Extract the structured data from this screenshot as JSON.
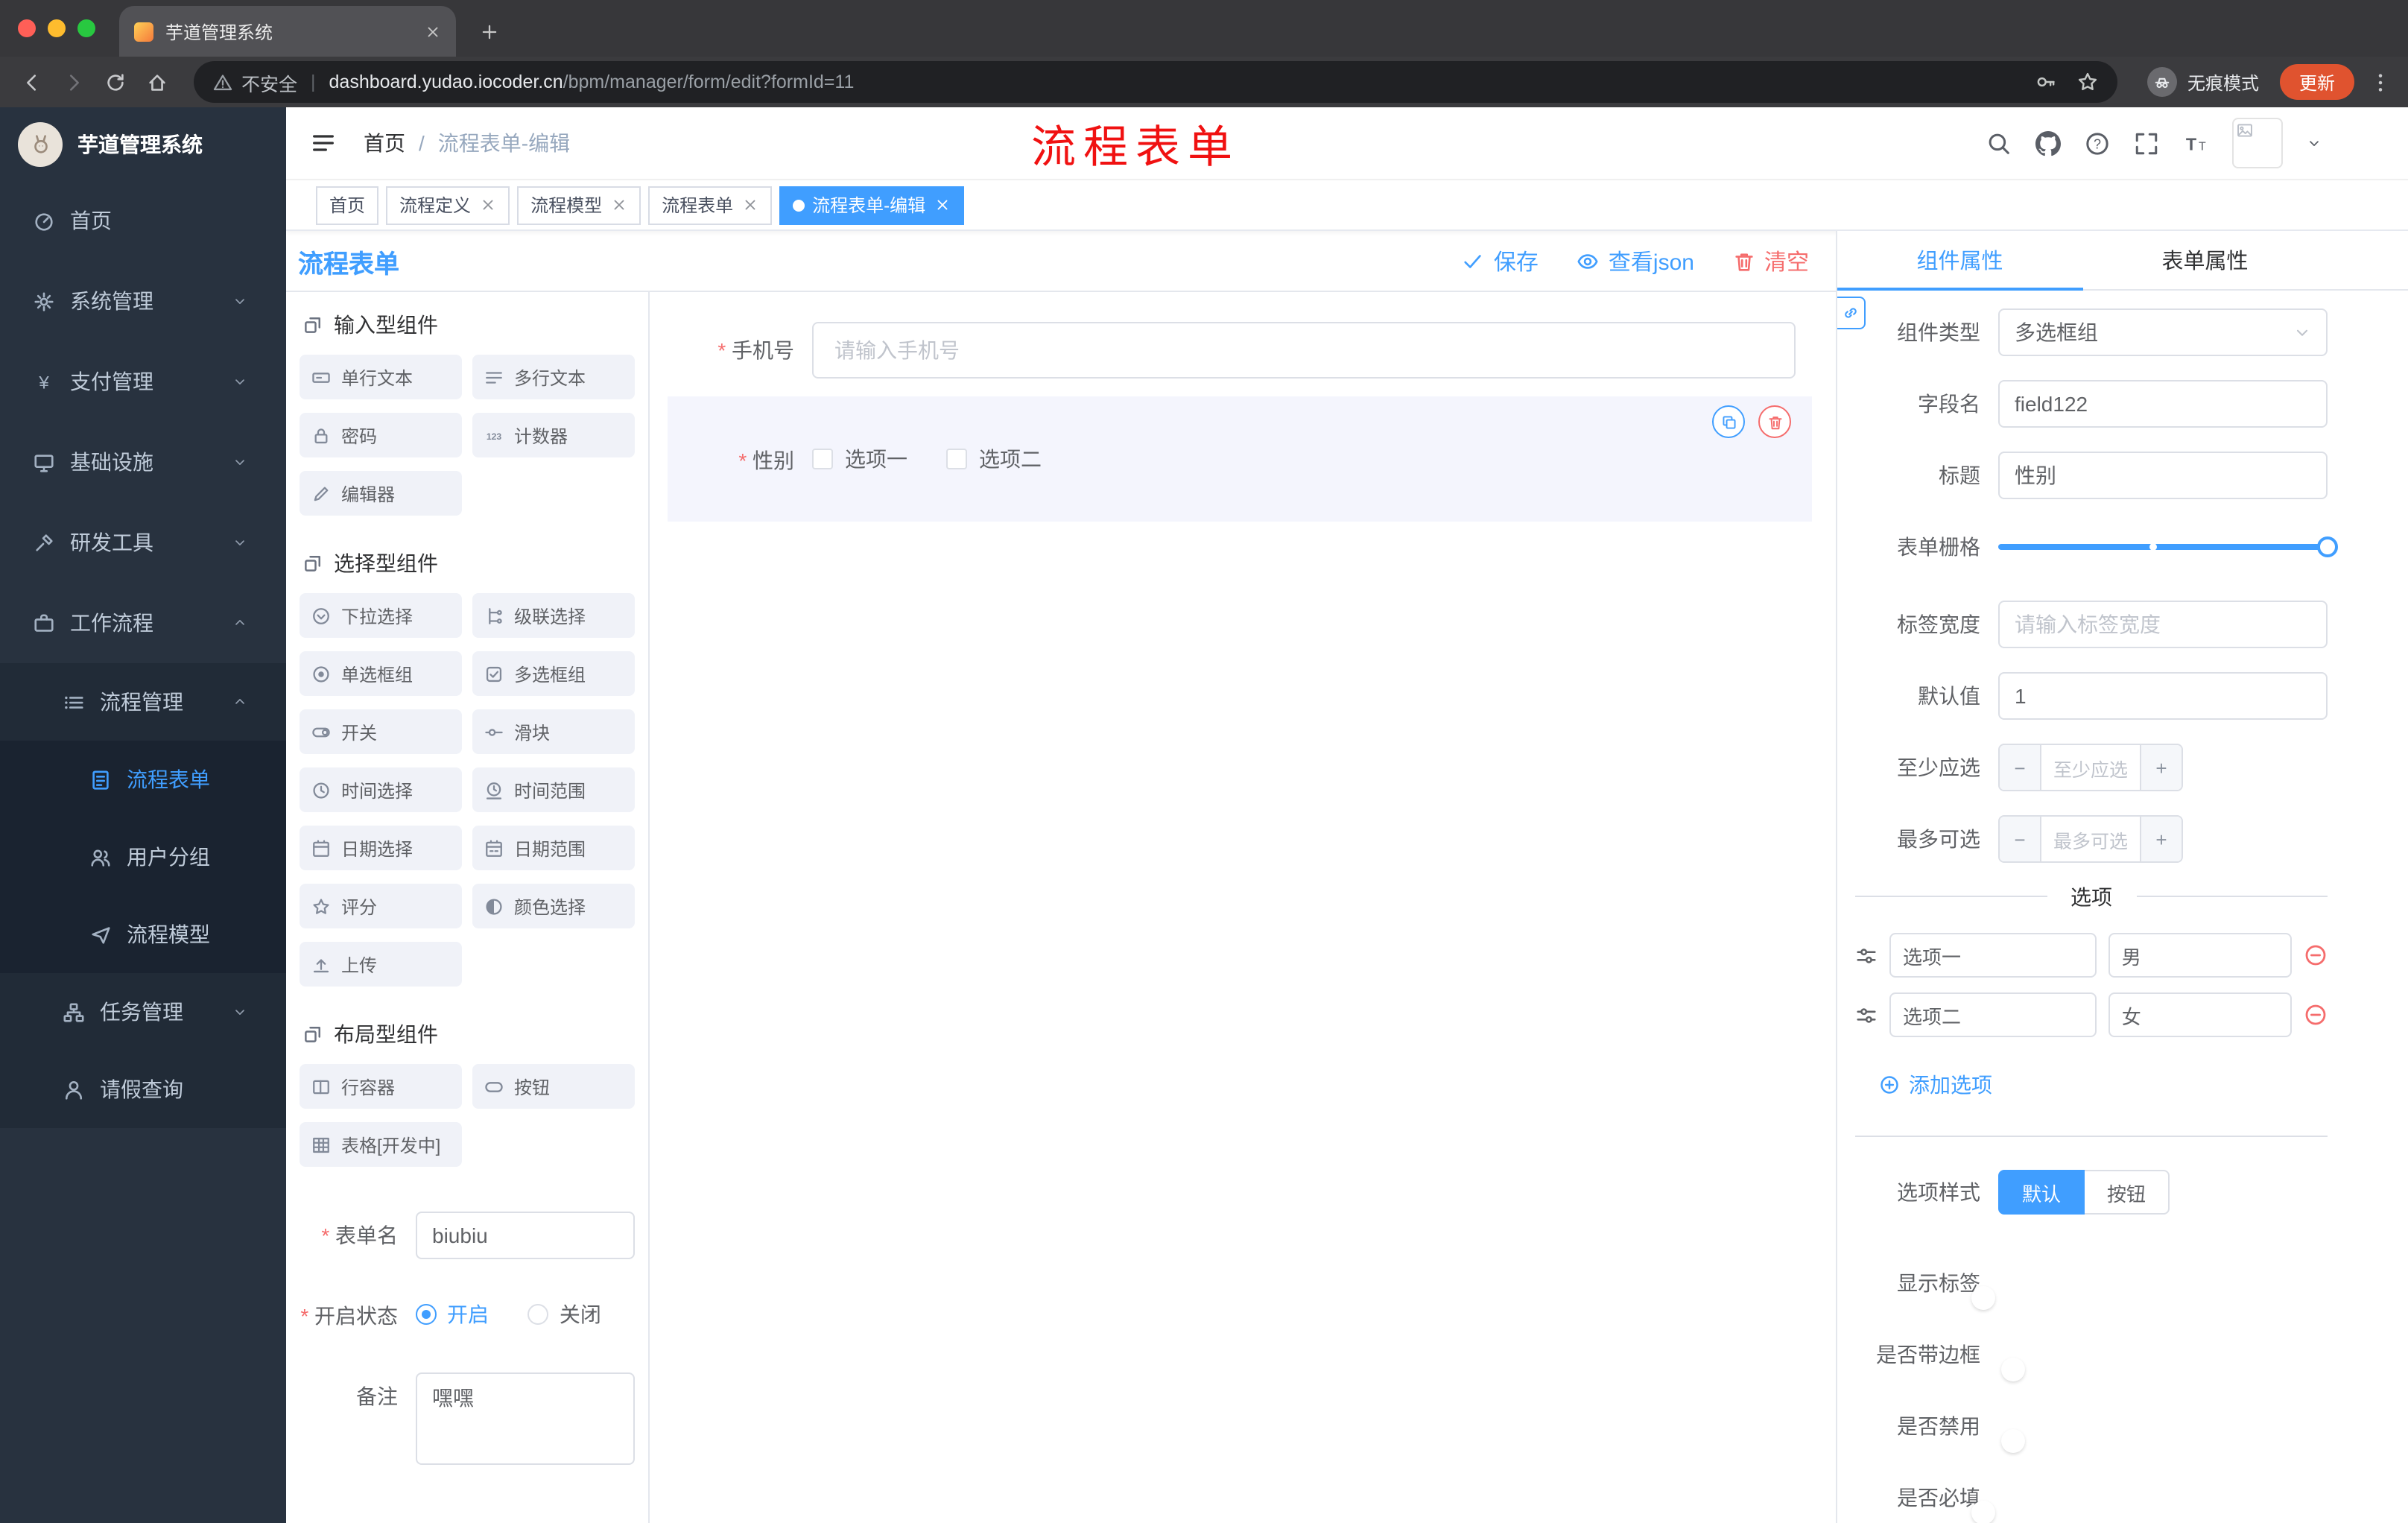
{
  "browser": {
    "tab_title": "芋道管理系统",
    "security_label": "不安全",
    "url_domain": "dashboard.yudao.iocoder.cn",
    "url_path": "/bpm/manager/form/edit?formId=11",
    "incognito_label": "无痕模式",
    "update_label": "更新"
  },
  "sidebar": {
    "title": "芋道管理系统",
    "menu": [
      {
        "key": "home",
        "label": "首页",
        "icon": "dashboard-icon",
        "level": 1
      },
      {
        "key": "system-management",
        "label": "系统管理",
        "icon": "gear-icon",
        "level": 1,
        "arrow": "down"
      },
      {
        "key": "payment-management",
        "label": "支付管理",
        "icon": "payment-icon",
        "level": 1,
        "arrow": "down"
      },
      {
        "key": "infrastructure",
        "label": "基础设施",
        "icon": "infrastructure-icon",
        "level": 1,
        "arrow": "down"
      },
      {
        "key": "dev-tools",
        "label": "研发工具",
        "icon": "devtools-icon",
        "level": 1,
        "arrow": "down"
      },
      {
        "key": "workflow",
        "label": "工作流程",
        "icon": "workflow-icon",
        "level": 1,
        "arrow": "up"
      },
      {
        "key": "process-management",
        "label": "流程管理",
        "icon": "process-icon",
        "level": 2,
        "arrow": "up"
      },
      {
        "key": "process-form",
        "label": "流程表单",
        "icon": "form-icon",
        "level": 3,
        "active": true
      },
      {
        "key": "user-group",
        "label": "用户分组",
        "icon": "user-group-icon",
        "level": 3
      },
      {
        "key": "process-model",
        "label": "流程模型",
        "icon": "model-icon",
        "level": 3
      },
      {
        "key": "task-management",
        "label": "任务管理",
        "icon": "task-icon",
        "level": 2,
        "arrow": "down"
      },
      {
        "key": "leave-query",
        "label": "请假查询",
        "icon": "leave-icon",
        "level": 2
      }
    ]
  },
  "header": {
    "breadcrumb_home": "首页",
    "breadcrumb_sep": "/",
    "breadcrumb_current": "流程表单-编辑",
    "annotation": "流程表单"
  },
  "tags": [
    {
      "label": "首页",
      "closable": false,
      "active": false
    },
    {
      "label": "流程定义",
      "closable": true,
      "active": false
    },
    {
      "label": "流程模型",
      "closable": true,
      "active": false
    },
    {
      "label": "流程表单",
      "closable": true,
      "active": false
    },
    {
      "label": "流程表单-编辑",
      "closable": true,
      "active": true
    }
  ],
  "designer": {
    "title": "流程表单",
    "actions": {
      "save": "保存",
      "view_json": "查看json",
      "clear": "清空"
    }
  },
  "palette": {
    "sections": [
      {
        "title": "输入型组件",
        "items": [
          {
            "label": "单行文本",
            "icon": "input-icon"
          },
          {
            "label": "多行文本",
            "icon": "textarea-icon"
          },
          {
            "label": "密码",
            "icon": "password-icon"
          },
          {
            "label": "计数器",
            "icon": "counter-icon"
          },
          {
            "label": "编辑器",
            "icon": "editor-icon"
          }
        ]
      },
      {
        "title": "选择型组件",
        "items": [
          {
            "label": "下拉选择",
            "icon": "select-icon"
          },
          {
            "label": "级联选择",
            "icon": "cascader-icon"
          },
          {
            "label": "单选框组",
            "icon": "radio-icon"
          },
          {
            "label": "多选框组",
            "icon": "checkbox-icon"
          },
          {
            "label": "开关",
            "icon": "switch-icon"
          },
          {
            "label": "滑块",
            "icon": "slider-icon"
          },
          {
            "label": "时间选择",
            "icon": "time-icon"
          },
          {
            "label": "时间范围",
            "icon": "time-range-icon"
          },
          {
            "label": "日期选择",
            "icon": "date-icon"
          },
          {
            "label": "日期范围",
            "icon": "date-range-icon"
          },
          {
            "label": "评分",
            "icon": "rate-icon"
          },
          {
            "label": "颜色选择",
            "icon": "color-icon"
          },
          {
            "label": "上传",
            "icon": "upload-icon"
          }
        ]
      },
      {
        "title": "布局型组件",
        "items": [
          {
            "label": "行容器",
            "icon": "row-icon"
          },
          {
            "label": "按钮",
            "icon": "button-icon"
          },
          {
            "label": "表格[开发中]",
            "icon": "table-icon"
          }
        ]
      }
    ],
    "form": {
      "name_label": "表单名",
      "name_value": "biubiu",
      "status_label": "开启状态",
      "status_on": "开启",
      "status_off": "关闭",
      "remark_label": "备注",
      "remark_value": "嘿嘿"
    }
  },
  "canvas": {
    "phone": {
      "label": "手机号",
      "placeholder": "请输入手机号"
    },
    "gender": {
      "label": "性别",
      "options": [
        "选项一",
        "选项二"
      ]
    }
  },
  "props": {
    "tab_component": "组件属性",
    "tab_form": "表单属性",
    "component_type_label": "组件类型",
    "component_type_value": "多选框组",
    "field_label": "字段名",
    "field_value": "field122",
    "title_label": "标题",
    "title_value": "性别",
    "grid_label": "表单栅格",
    "label_width_label": "标签宽度",
    "label_width_placeholder": "请输入标签宽度",
    "default_label": "默认值",
    "default_value": "1",
    "min_label": "至少应选",
    "min_placeholder": "至少应选",
    "max_label": "最多可选",
    "max_placeholder": "最多可选",
    "options_divider": "选项",
    "options": [
      {
        "label": "选项一",
        "value": "男"
      },
      {
        "label": "选项二",
        "value": "女"
      }
    ],
    "add_option": "添加选项",
    "style_label": "选项样式",
    "style_default": "默认",
    "style_button": "按钮",
    "toggles": [
      {
        "label": "显示标签",
        "on": true
      },
      {
        "label": "是否带边框",
        "on": false
      },
      {
        "label": "是否禁用",
        "on": false
      },
      {
        "label": "是否必填",
        "on": true
      }
    ]
  }
}
